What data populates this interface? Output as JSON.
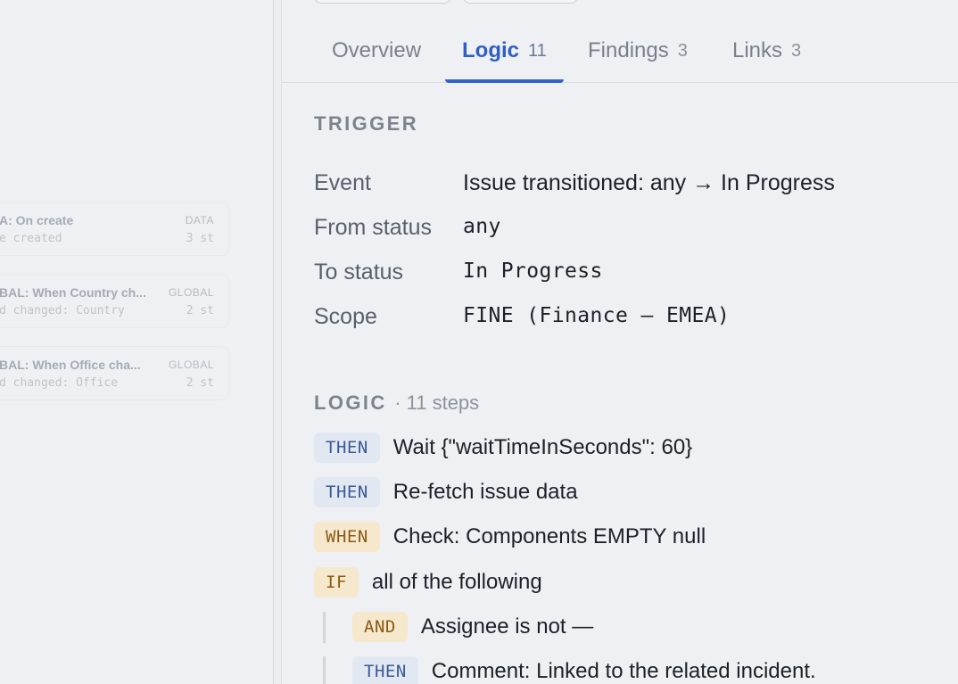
{
  "sidebar": {
    "cards": [
      {
        "title": "A: On create",
        "badge": "DATA",
        "sub": "e created",
        "steps": "3 st"
      },
      {
        "title": "BAL: When Country ch...",
        "badge": "GLOBAL",
        "sub": "d changed: Country",
        "steps": "2 st"
      },
      {
        "title": "BAL: When Office cha...",
        "badge": "GLOBAL",
        "sub": "d changed: Office",
        "steps": "2 st"
      }
    ]
  },
  "tabs": [
    {
      "label": "Overview",
      "count": ""
    },
    {
      "label": "Logic",
      "count": "11"
    },
    {
      "label": "Findings",
      "count": "3"
    },
    {
      "label": "Links",
      "count": "3"
    }
  ],
  "trigger": {
    "title": "TRIGGER",
    "rows": [
      {
        "label": "Event",
        "value": "Issue transitioned: any → In Progress"
      },
      {
        "label": "From status",
        "value": "any"
      },
      {
        "label": "To status",
        "value": "In Progress"
      },
      {
        "label": "Scope",
        "value": "FINE (Finance – EMEA)"
      }
    ]
  },
  "logic": {
    "title": "LOGIC",
    "subtitle": "· 11 steps",
    "steps": [
      {
        "tag": "THEN",
        "text": "Wait {\"waitTimeInSeconds\": 60}"
      },
      {
        "tag": "THEN",
        "text": "Re-fetch issue data"
      },
      {
        "tag": "WHEN",
        "text": "Check: Components EMPTY null"
      },
      {
        "tag": "IF",
        "text": "all of the following"
      },
      {
        "tag": "AND",
        "text": "Assignee is not —"
      },
      {
        "tag": "THEN",
        "text": "Comment: Linked to the related incident."
      }
    ]
  }
}
